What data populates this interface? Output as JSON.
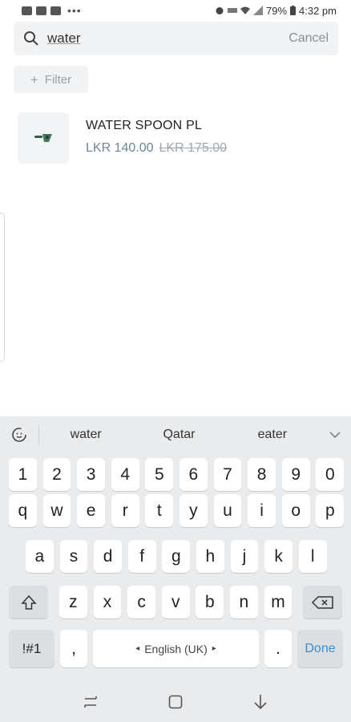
{
  "status_bar": {
    "battery": "79%",
    "time": "4:32 pm",
    "dots": "•••"
  },
  "search": {
    "query": "water",
    "cancel_label": "Cancel"
  },
  "filter": {
    "plus": "+",
    "label": "Filter"
  },
  "products": [
    {
      "name": "WATER SPOON PL",
      "sale_price": "LKR 140.00",
      "original_price": "LKR 175.00"
    }
  ],
  "keyboard": {
    "suggestions": [
      "water",
      "Qatar",
      "eater"
    ],
    "number_row": [
      "1",
      "2",
      "3",
      "4",
      "5",
      "6",
      "7",
      "8",
      "9",
      "0"
    ],
    "row1": [
      "q",
      "w",
      "e",
      "r",
      "t",
      "y",
      "u",
      "i",
      "o",
      "p"
    ],
    "row2": [
      "a",
      "s",
      "d",
      "f",
      "g",
      "h",
      "j",
      "k",
      "l"
    ],
    "row3": [
      "z",
      "x",
      "c",
      "v",
      "b",
      "n",
      "m"
    ],
    "symbols_label": "!#1",
    "comma_label": ",",
    "space_label": "English (UK)",
    "period_label": ".",
    "done_label": "Done"
  },
  "icons": {
    "search": "search-icon",
    "shift": "shift-icon",
    "backspace": "backspace-icon",
    "emoji_toggle": "emoji-toggle-icon",
    "expand": "chevron-down-icon",
    "nav_recents": "recent-apps-icon",
    "nav_home": "home-icon",
    "nav_back": "back-icon"
  },
  "colors": {
    "sale_price": "#6f8797",
    "old_price": "#9aa9b4",
    "done": "#3a8fd1",
    "keyboard_bg": "#e9ebed"
  }
}
